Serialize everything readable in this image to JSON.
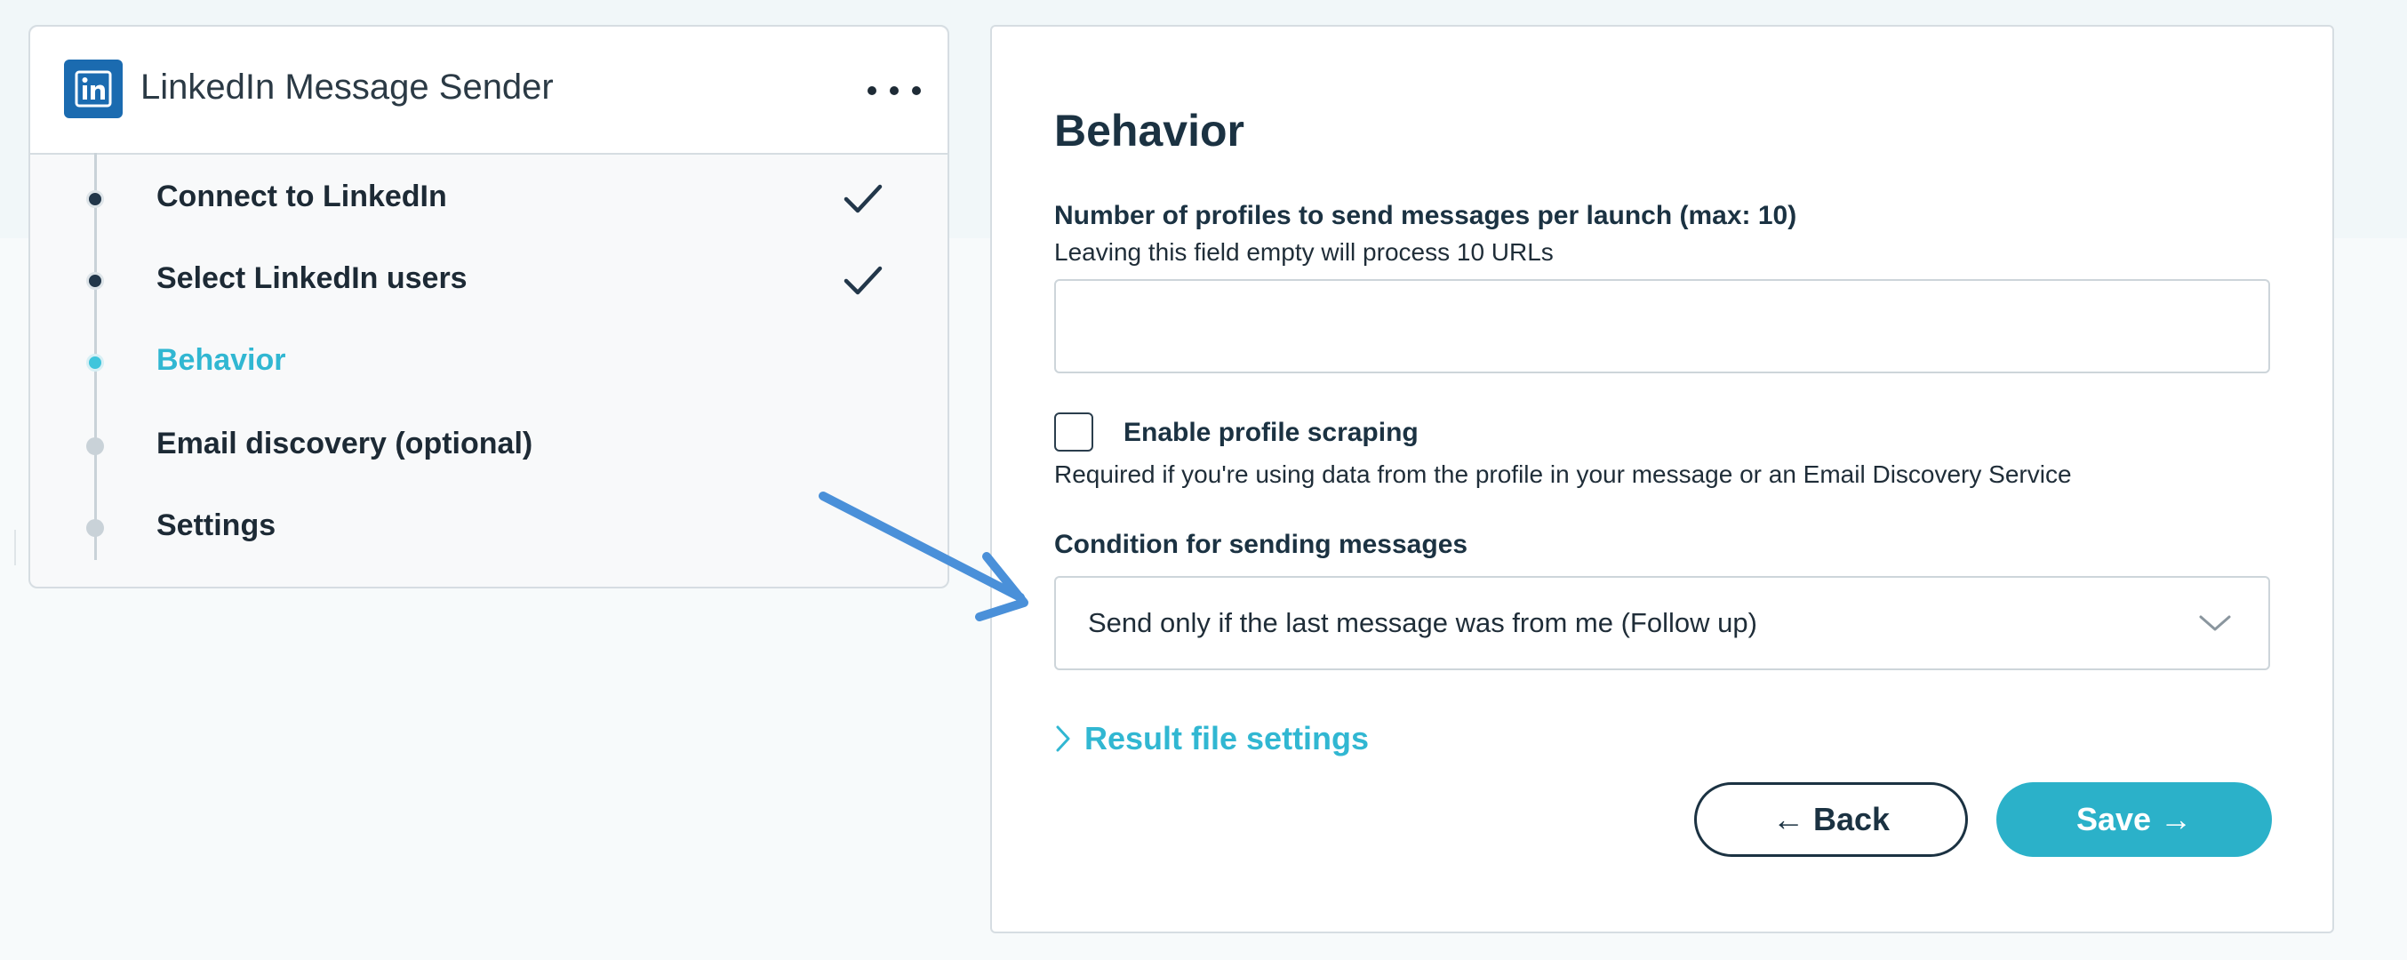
{
  "app": {
    "title": "LinkedIn Message Sender",
    "logo_icon": "linkedin-icon",
    "more_icon": "more-horizontal-icon"
  },
  "steps": [
    {
      "label": "Connect to LinkedIn",
      "state": "done"
    },
    {
      "label": "Select LinkedIn users",
      "state": "done"
    },
    {
      "label": "Behavior",
      "state": "active"
    },
    {
      "label": "Email discovery (optional)",
      "state": "pending"
    },
    {
      "label": "Settings",
      "state": "pending"
    }
  ],
  "behavior": {
    "title": "Behavior",
    "profiles_field": {
      "label": "Number of profiles to send messages per launch (max: 10)",
      "help": "Leaving this field empty will process 10 URLs",
      "value": "",
      "placeholder": ""
    },
    "scraping": {
      "label": "Enable profile scraping",
      "checked": false,
      "help": "Required if you're using data from the profile in your message or an Email Discovery Service"
    },
    "condition": {
      "label": "Condition for sending messages",
      "selected": "Send only if the last message was from me (Follow up)"
    },
    "result_file_settings": "Result file settings",
    "back_label": "← Back",
    "save_label": "Save →"
  },
  "colors": {
    "accent": "#31b7d2",
    "save_button": "#2bb1c9",
    "dark_text": "#1b3242",
    "linkedin_blue": "#1b6bb0",
    "annotation_arrow": "#4a90d9"
  }
}
